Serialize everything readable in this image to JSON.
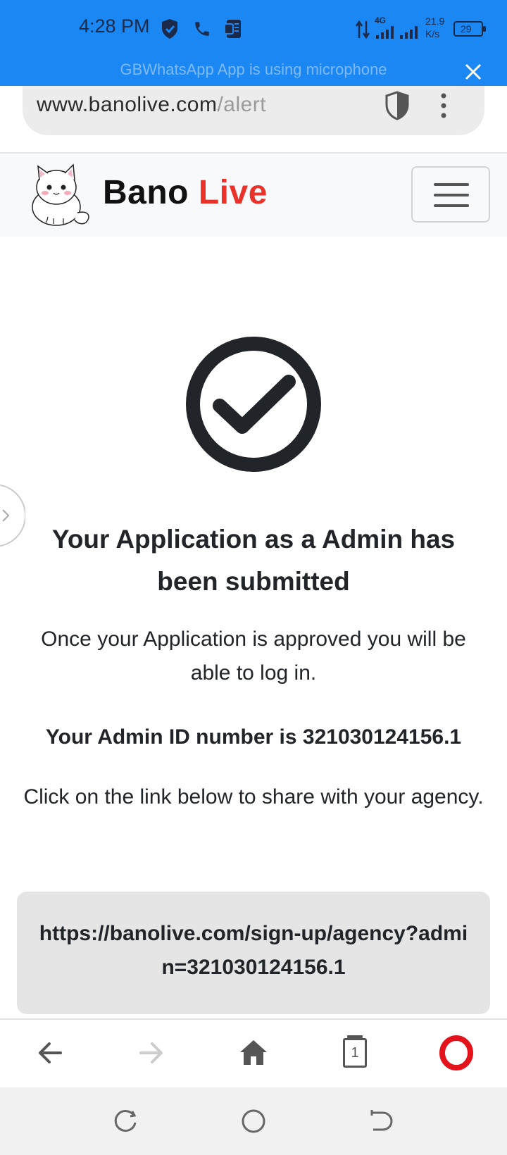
{
  "status_bar": {
    "time": "4:28 PM",
    "network_type": "4G",
    "speed_value": "21.9",
    "speed_unit": "K/s",
    "battery": "29",
    "notification": "GBWhatsApp App is using microphone"
  },
  "browser": {
    "url_domain": "www.banolive.com",
    "url_path": "/alert",
    "tab_count": "1"
  },
  "navbar": {
    "brand_first": "Bano",
    "brand_second": "Live"
  },
  "content": {
    "heading": "Your Application as a Admin has been submitted",
    "approval_message": "Once your Application is approved you will be able to log in.",
    "admin_id_text": "Your Admin ID number is 321030124156.1",
    "share_instruction": "Click on the link below to share with your agency.",
    "share_link": "https://banolive.com/sign-up/agency?admin=321030124156.1"
  },
  "colors": {
    "status_bar": "#1a87f3",
    "brand_live": "#e8322a",
    "opera_red": "#e3121b"
  },
  "icons": {
    "status": [
      "shield-icon",
      "phone-icon",
      "voicemail-icon",
      "data-arrows-icon",
      "signal-icon",
      "battery-icon"
    ],
    "browser": [
      "back-arrow-icon",
      "forward-arrow-icon",
      "home-icon",
      "tabs-icon",
      "opera-icon"
    ],
    "system": [
      "recent-apps-icon",
      "home-circle-icon",
      "back-icon"
    ]
  }
}
